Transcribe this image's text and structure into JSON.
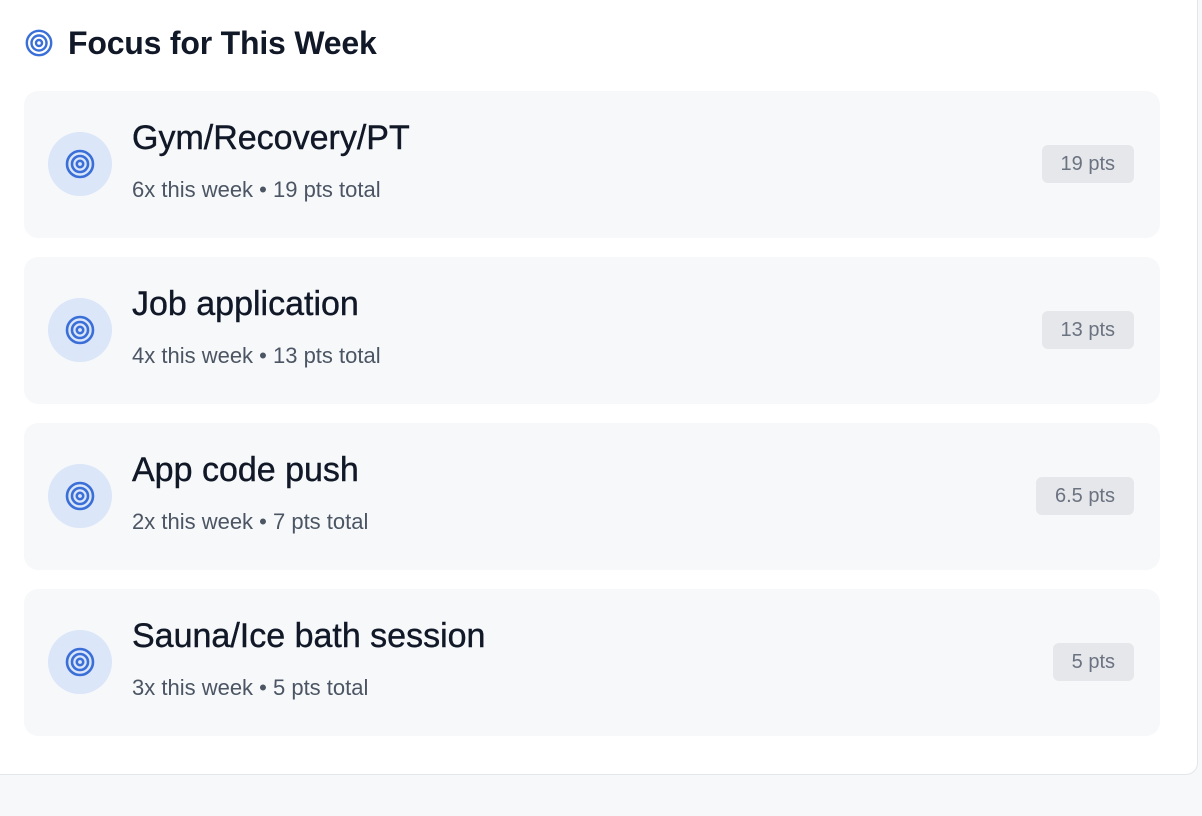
{
  "header": {
    "title": "Focus for This Week",
    "icon": "target-icon"
  },
  "colors": {
    "accent": "#3b6fd8",
    "icon_bg": "#dbe6f9",
    "card_bg": "#f7f8fa",
    "badge_bg": "#e5e7eb",
    "badge_text": "#6b7280",
    "title_text": "#111827",
    "sub_text": "#4b5563"
  },
  "items": [
    {
      "title": "Gym/Recovery/PT",
      "subtitle": "6x this week • 19 pts total",
      "badge": "19 pts",
      "icon": "target-icon"
    },
    {
      "title": "Job application",
      "subtitle": "4x this week • 13 pts total",
      "badge": "13 pts",
      "icon": "target-icon"
    },
    {
      "title": "App code push",
      "subtitle": "2x this week • 7 pts total",
      "badge": "6.5 pts",
      "icon": "target-icon"
    },
    {
      "title": "Sauna/Ice bath session",
      "subtitle": "3x this week • 5 pts total",
      "badge": "5 pts",
      "icon": "target-icon"
    }
  ]
}
